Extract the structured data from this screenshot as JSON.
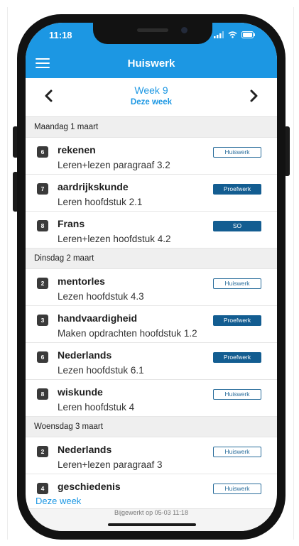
{
  "status_bar": {
    "time": "11:18",
    "icons": [
      "signal-icon",
      "wifi-icon",
      "battery-icon"
    ]
  },
  "nav": {
    "title": "Huiswerk",
    "menu_icon": "hamburger-menu-icon"
  },
  "week": {
    "title": "Week 9",
    "subtitle": "Deze week",
    "prev_icon": "chevron-left-icon",
    "next_icon": "chevron-right-icon"
  },
  "days": [
    {
      "label": "Maandag 1 maart",
      "items": [
        {
          "period": "6",
          "subject": "rekenen",
          "description": "Leren+lezen paragraaf 3.2",
          "badge": "Huiswerk",
          "badge_style": "outline"
        },
        {
          "period": "7",
          "subject": "aardrijkskunde",
          "description": "Leren hoofdstuk 2.1",
          "badge": "Proefwerk",
          "badge_style": "filled"
        },
        {
          "period": "8",
          "subject": "Frans",
          "description": "Leren+lezen hoofdstuk 4.2",
          "badge": "SO",
          "badge_style": "filled"
        }
      ]
    },
    {
      "label": "Dinsdag 2 maart",
      "items": [
        {
          "period": "2",
          "subject": "mentorles",
          "description": "Lezen hoofdstuk 4.3",
          "badge": "Huiswerk",
          "badge_style": "outline"
        },
        {
          "period": "3",
          "subject": "handvaardigheid",
          "description": "Maken opdrachten hoofdstuk 1.2",
          "badge": "Proefwerk",
          "badge_style": "filled"
        },
        {
          "period": "6",
          "subject": "Nederlands",
          "description": "Lezen hoofdstuk 6.1",
          "badge": "Proefwerk",
          "badge_style": "filled"
        },
        {
          "period": "8",
          "subject": "wiskunde",
          "description": "Leren hoofdstuk 4",
          "badge": "Huiswerk",
          "badge_style": "outline"
        }
      ]
    },
    {
      "label": "Woensdag 3 maart",
      "items": [
        {
          "period": "2",
          "subject": "Nederlands",
          "description": "Leren+lezen paragraaf 3",
          "badge": "Huiswerk",
          "badge_style": "outline"
        },
        {
          "period": "4",
          "subject": "geschiedenis",
          "description": "",
          "badge": "Huiswerk",
          "badge_style": "outline"
        }
      ]
    }
  ],
  "footer": {
    "link": "Deze week",
    "updated": "Bijgewerkt op 05-03 11:18"
  },
  "colors": {
    "accent": "#1c97e3",
    "badge_filled": "#135d91",
    "badge_outline": "#2b6e9c"
  }
}
